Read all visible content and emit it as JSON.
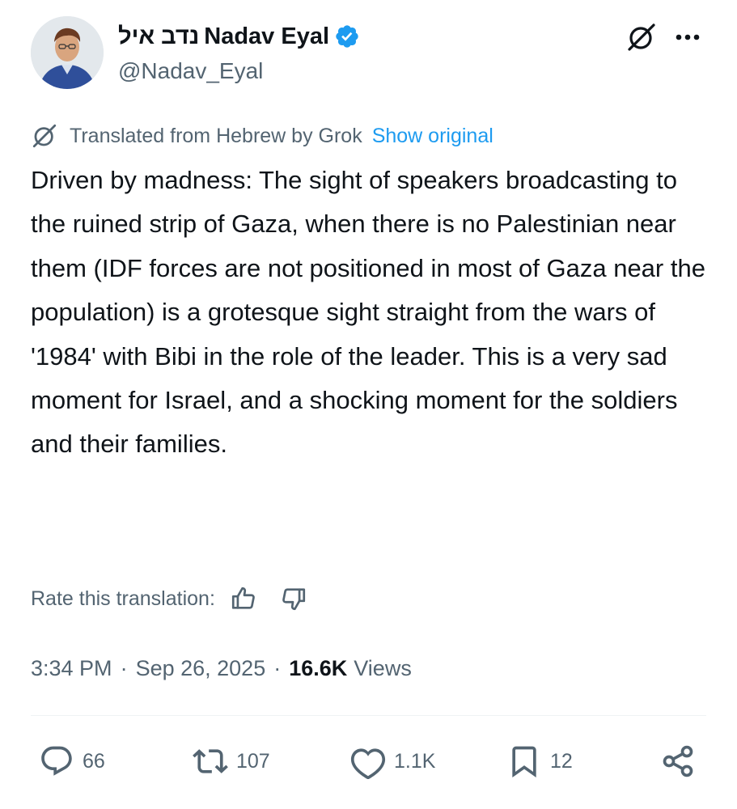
{
  "author": {
    "display_name_hebrew": "נדב איל",
    "display_name": "Nadav Eyal",
    "handle": "@Nadav_Eyal",
    "verified": true
  },
  "translation": {
    "label": "Translated from Hebrew by Grok",
    "show_original": "Show original",
    "rate_label": "Rate this translation:"
  },
  "tweet": {
    "text": "Driven by madness: The sight of speakers broadcasting to the ruined strip of Gaza, when there is no Palestinian near them (IDF forces are not positioned in most of Gaza near the population) is a grotesque sight straight from the wars of '1984' with Bibi in the role of the leader. This is a very sad moment for Israel, and a shocking moment for the soldiers and their families.",
    "time": "3:34 PM",
    "separator": "·",
    "date": "Sep 26, 2025",
    "views_count": "16.6K",
    "views_label": "Views"
  },
  "actions": {
    "replies": "66",
    "reposts": "107",
    "likes": "1.1K",
    "bookmarks": "12"
  },
  "icons": {
    "verified": "verified-badge-icon",
    "grok": "grok-icon",
    "more": "more-icon",
    "thumbs_up": "thumbs-up-icon",
    "thumbs_down": "thumbs-down-icon",
    "reply": "reply-icon",
    "repost": "repost-icon",
    "like": "heart-icon",
    "bookmark": "bookmark-icon",
    "share": "share-icon"
  },
  "colors": {
    "accent": "#1d9bf0",
    "text_primary": "#0f1419",
    "text_secondary": "#536471",
    "divider": "#eff3f4"
  }
}
